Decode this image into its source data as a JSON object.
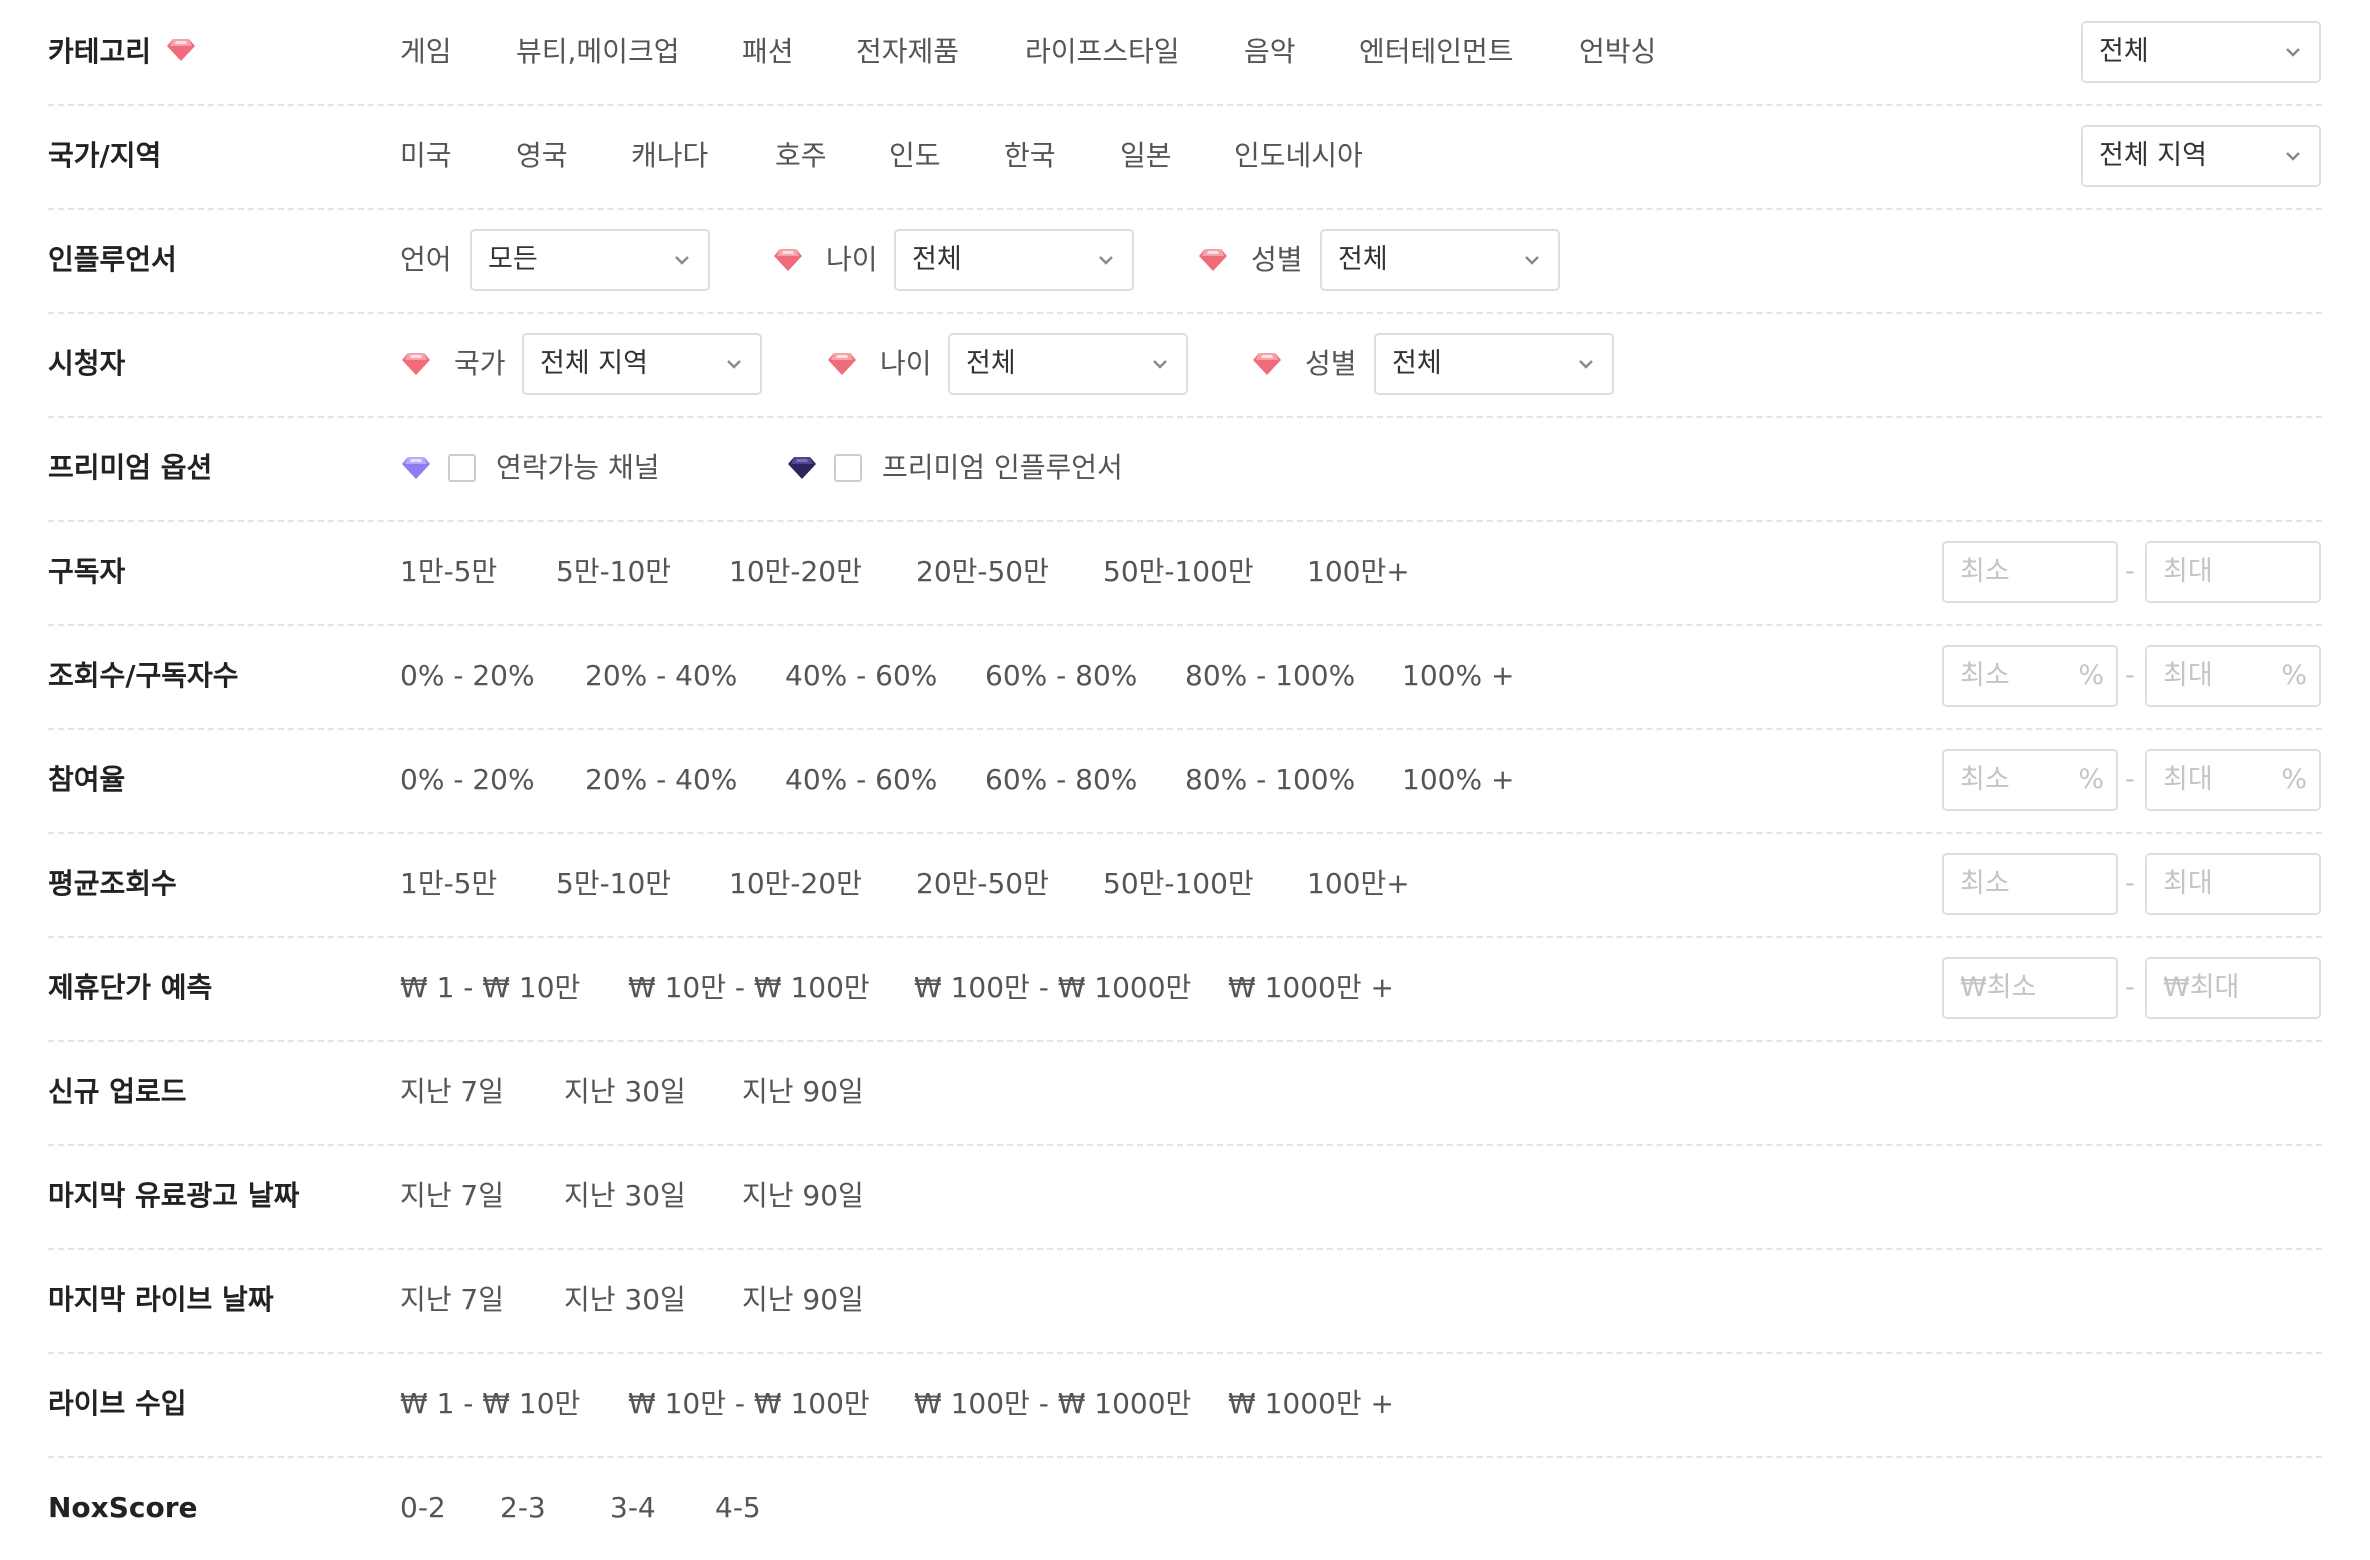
{
  "filters": {
    "category": {
      "label": "카테고리",
      "options": [
        "게임",
        "뷰티,메이크업",
        "패션",
        "전자제품",
        "라이프스타일",
        "음악",
        "엔터테인먼트",
        "언박싱"
      ],
      "select": "전체"
    },
    "region": {
      "label": "국가/지역",
      "options": [
        "미국",
        "영국",
        "캐나다",
        "호주",
        "인도",
        "한국",
        "일본",
        "인도네시아"
      ],
      "select": "전체 지역"
    },
    "influencer": {
      "label": "인플루언서",
      "language_label": "언어",
      "language_value": "모든",
      "age_label": "나이",
      "age_value": "전체",
      "gender_label": "성별",
      "gender_value": "전체"
    },
    "audience": {
      "label": "시청자",
      "country_label": "국가",
      "country_value": "전체 지역",
      "age_label": "나이",
      "age_value": "전체",
      "gender_label": "성별",
      "gender_value": "전체"
    },
    "premium": {
      "label": "프리미엄 옵션",
      "contactable_label": "연락가능 채널",
      "premium_influencer_label": "프리미엄 인플루언서"
    },
    "subscribers": {
      "label": "구독자",
      "options": [
        "1만-5만",
        "5만-10만",
        "10만-20만",
        "20만-50만",
        "50만-100만",
        "100만+"
      ],
      "min_placeholder": "최소",
      "max_placeholder": "최대"
    },
    "views_ratio": {
      "label": "조회수/구독자수",
      "options": [
        "0% - 20%",
        "20% - 40%",
        "40% - 60%",
        "60% - 80%",
        "80% - 100%",
        "100% +"
      ],
      "min_placeholder": "최소",
      "max_placeholder": "최대",
      "unit": "%"
    },
    "engagement": {
      "label": "참여율",
      "options": [
        "0% - 20%",
        "20% - 40%",
        "40% - 60%",
        "60% - 80%",
        "80% - 100%",
        "100% +"
      ],
      "min_placeholder": "최소",
      "max_placeholder": "최대",
      "unit": "%"
    },
    "avg_views": {
      "label": "평균조회수",
      "options": [
        "1만-5만",
        "5만-10만",
        "10만-20만",
        "20만-50만",
        "50만-100만",
        "100만+"
      ],
      "min_placeholder": "최소",
      "max_placeholder": "최대"
    },
    "price": {
      "label": "제휴단가 예측",
      "options": [
        "₩ 1 - ₩ 10만",
        "₩ 10만 - ₩ 100만",
        "₩ 100만 - ₩ 1000만",
        "₩ 1000만 +"
      ],
      "min_placeholder": "₩최소",
      "max_placeholder": "₩최대"
    },
    "new_upload": {
      "label": "신규 업로드",
      "options": [
        "지난 7일",
        "지난 30일",
        "지난 90일"
      ]
    },
    "last_paid_ad": {
      "label": "마지막 유료광고 날짜",
      "options": [
        "지난 7일",
        "지난 30일",
        "지난 90일"
      ]
    },
    "last_live": {
      "label": "마지막 라이브 날짜",
      "options": [
        "지난 7일",
        "지난 30일",
        "지난 90일"
      ]
    },
    "live_income": {
      "label": "라이브 수입",
      "options": [
        "₩ 1 - ₩ 10만",
        "₩ 10만 - ₩ 100만",
        "₩ 100만 - ₩ 1000만",
        "₩ 1000만 +"
      ]
    },
    "noxscore": {
      "label": "NoxScore",
      "options": [
        "0-2",
        "2-3",
        "3-4",
        "4-5"
      ]
    }
  },
  "dash": "-",
  "icons": {
    "gem_red": "gem-icon",
    "gem_purple": "gem-icon",
    "gem_navy": "gem-icon",
    "chevron": "chevron-down-icon"
  },
  "colors": {
    "gem_red": "#f06c7a",
    "gem_purple": "#8d7cf2",
    "gem_navy": "#2b2660",
    "divider": "#e4e4e4"
  }
}
